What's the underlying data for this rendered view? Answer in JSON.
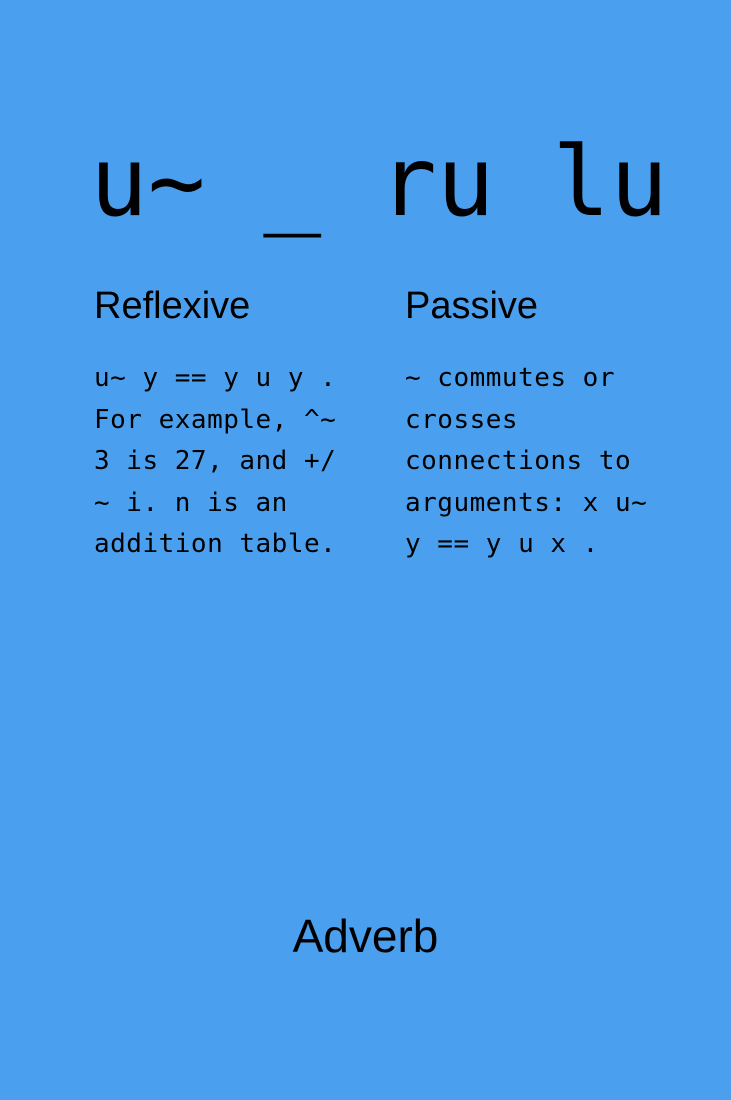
{
  "card": {
    "background_color": "#4aa0ef",
    "symbol": "u~ _ ru lu",
    "sections": [
      {
        "heading": "Reflexive",
        "text": "u~ y == y u y .\nFor example, ^~\n3 is 27, and +/\n~ i. n is an\naddition table."
      },
      {
        "heading": "Passive",
        "text": "~ commutes or\ncrosses\nconnections to\narguments: x u~\ny == y u x ."
      }
    ],
    "category": "Adverb"
  }
}
